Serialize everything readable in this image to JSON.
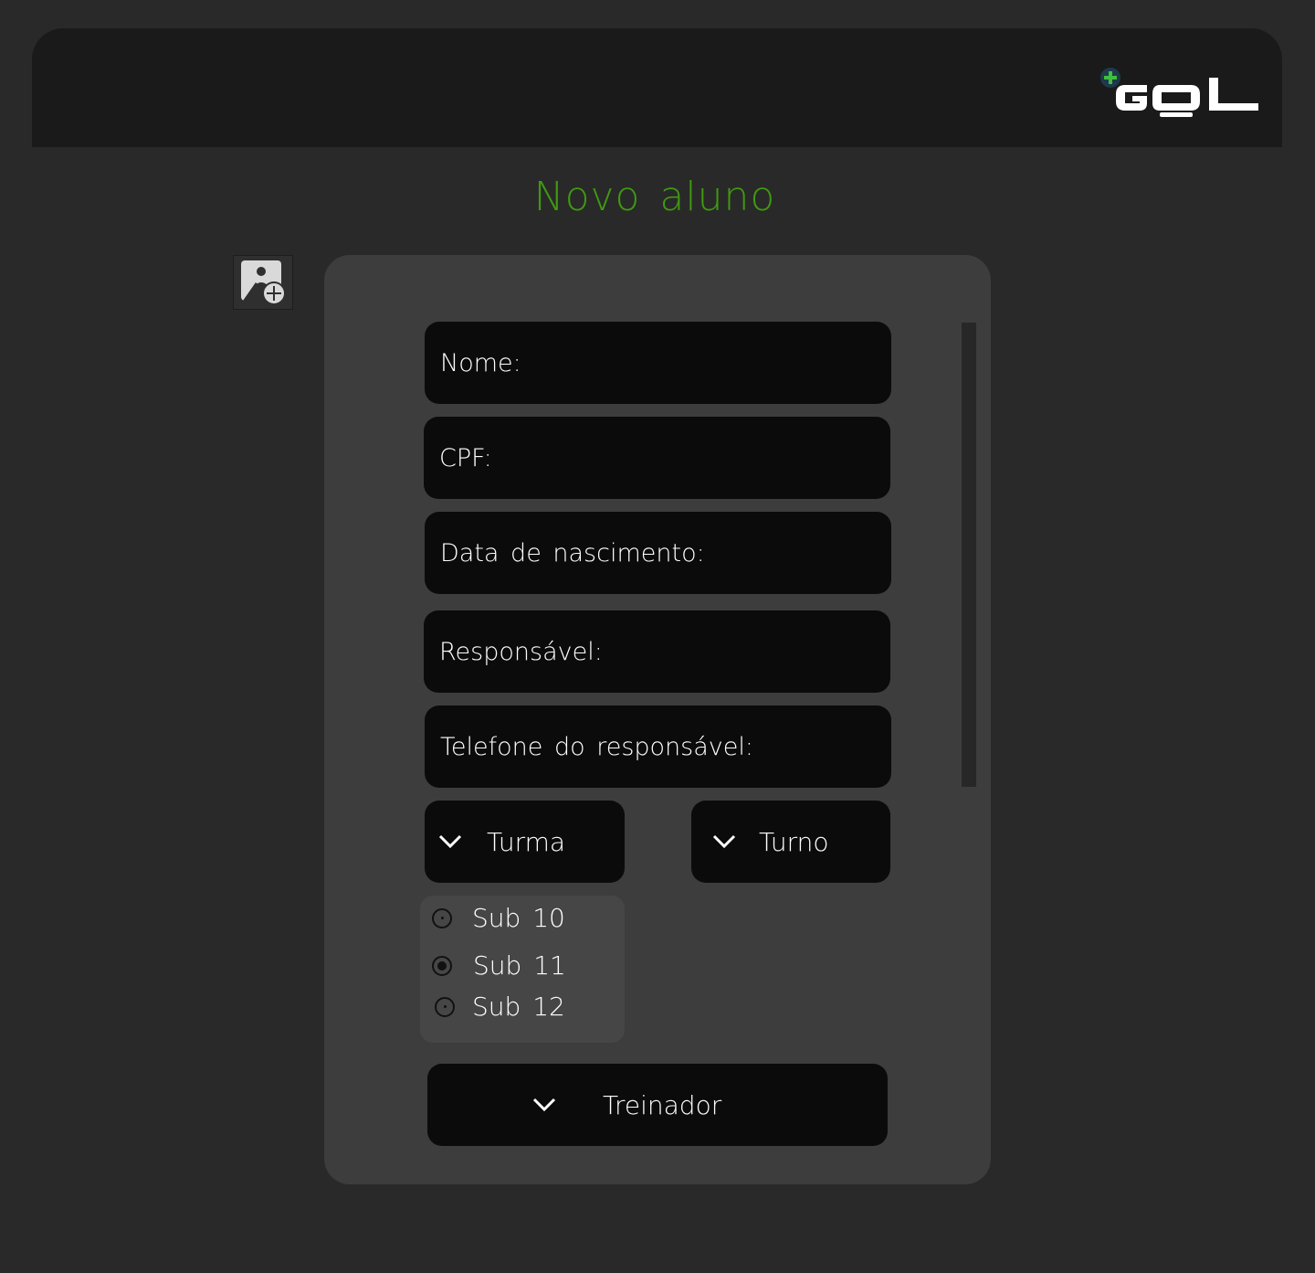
{
  "header": {
    "logo_text": "GOL",
    "brand_color": "#3f9a10"
  },
  "page": {
    "title": "Novo aluno"
  },
  "photo_upload": {
    "icon": "add-photo-icon"
  },
  "form": {
    "fields": {
      "nome": "Nome:",
      "cpf": "CPF:",
      "data_nascimento": "Data de nascimento:",
      "responsavel": "Responsável:",
      "telefone_responsavel": "Telefone do responsável:"
    },
    "turma_label": "Turma",
    "turno_label": "Turno",
    "turma_options": [
      {
        "label": "Sub 10",
        "checked": false
      },
      {
        "label": "Sub 11",
        "checked": true
      },
      {
        "label": "Sub 12",
        "checked": false
      }
    ],
    "treinador_label": "Treinador"
  }
}
